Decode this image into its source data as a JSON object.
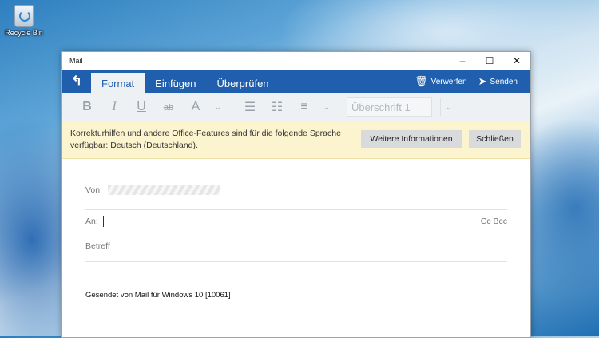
{
  "desktop": {
    "recycle_bin_label": "Recycle Bin"
  },
  "window": {
    "title": "Mail",
    "controls": {
      "minimize": "–",
      "maximize": "☐",
      "close": "✕"
    }
  },
  "ribbon": {
    "back_icon": "back-arrow-icon",
    "tabs": [
      {
        "label": "Format",
        "active": true
      },
      {
        "label": "Einfügen",
        "active": false
      },
      {
        "label": "Überprüfen",
        "active": false
      }
    ],
    "discard_label": "Verwerfen",
    "send_label": "Senden"
  },
  "toolbar": {
    "bold": "B",
    "italic": "I",
    "underline": "U",
    "highlight": "ab",
    "font_color": "A",
    "style_value": "Überschrift 1"
  },
  "infobar": {
    "message": "Korrekturhilfen und andere Office-Features sind für die folgende Sprache verfügbar: Deutsch (Deutschland).",
    "more_info_label": "Weitere Informationen",
    "close_label": "Schließen"
  },
  "compose": {
    "from_label": "Von:",
    "to_label": "An:",
    "cc_bcc_label": "Cc Bcc",
    "subject_placeholder": "Betreff",
    "body": "Gesendet von Mail für Windows 10 [10061]"
  }
}
